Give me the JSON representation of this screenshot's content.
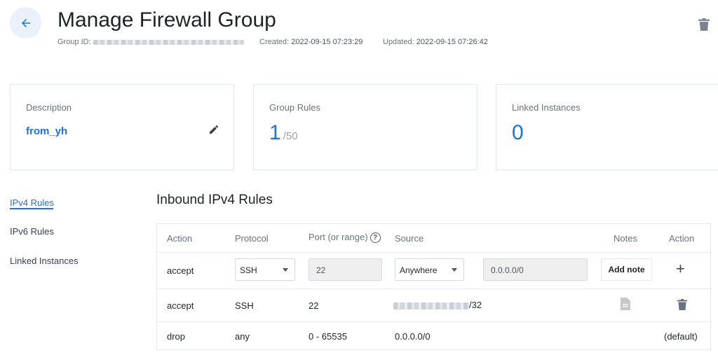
{
  "header": {
    "title": "Manage Firewall Group",
    "group_id_label": "Group ID:",
    "created_label": "Created:",
    "created_value": "2022-09-15 07:23:29",
    "updated_label": "Updated:",
    "updated_value": "2022-09-15 07:26:42"
  },
  "cards": {
    "description": {
      "label": "Description",
      "value": "from_yh"
    },
    "group_rules": {
      "label": "Group Rules",
      "value": "1",
      "max": "/50"
    },
    "linked_instances": {
      "label": "Linked Instances",
      "value": "0"
    }
  },
  "nav": {
    "items": [
      {
        "label": "IPv4 Rules",
        "active": true
      },
      {
        "label": "IPv6 Rules",
        "active": false
      },
      {
        "label": "Linked Instances",
        "active": false
      }
    ]
  },
  "section_title": "Inbound IPv4 Rules",
  "table": {
    "headers": {
      "action": "Action",
      "protocol": "Protocol",
      "port": "Port (or range)",
      "source": "Source",
      "notes": "Notes",
      "action_right": "Action"
    },
    "new_rule": {
      "action": "accept",
      "protocol": "SSH",
      "port": "22",
      "source_type": "Anywhere",
      "source_value": "0.0.0.0/0",
      "add_note_label": "Add note",
      "add_icon": "plus-icon"
    },
    "rules": [
      {
        "action": "accept",
        "protocol": "SSH",
        "port": "22",
        "source_suffix": "/32"
      },
      {
        "action": "drop",
        "protocol": "any",
        "port": "0 - 65535",
        "source": "0.0.0.0/0",
        "default_label": "(default)"
      }
    ]
  },
  "colors": {
    "accent": "#1a73e8",
    "muted": "#6b7280",
    "border": "#e3e6ea"
  }
}
